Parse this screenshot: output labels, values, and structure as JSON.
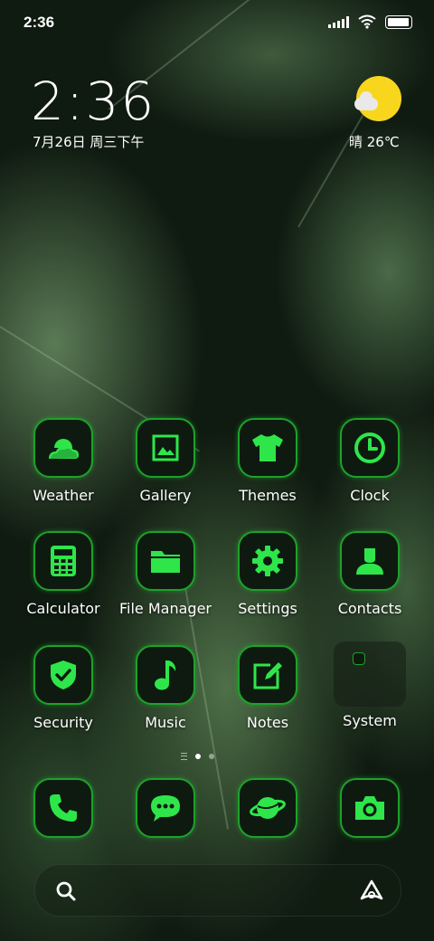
{
  "status_bar": {
    "time": "2:36"
  },
  "lockwidget": {
    "time": "2:36",
    "date": "7月26日 周三下午",
    "weather": "晴 26℃"
  },
  "apps": [
    {
      "label": "Weather",
      "icon": "weather-icon"
    },
    {
      "label": "Gallery",
      "icon": "gallery-icon"
    },
    {
      "label": "Themes",
      "icon": "tshirt-icon"
    },
    {
      "label": "Clock",
      "icon": "clock-icon"
    },
    {
      "label": "Calculator",
      "icon": "calculator-icon"
    },
    {
      "label": "File Manager",
      "icon": "folder-icon"
    },
    {
      "label": "Settings",
      "icon": "gear-icon"
    },
    {
      "label": "Contacts",
      "icon": "contact-icon"
    },
    {
      "label": "Security",
      "icon": "shield-icon"
    },
    {
      "label": "Music",
      "icon": "music-note-icon"
    },
    {
      "label": "Notes",
      "icon": "notes-icon"
    },
    {
      "label": "System",
      "icon": "folder-group-icon"
    }
  ],
  "dock": [
    {
      "icon": "phone-icon"
    },
    {
      "icon": "messages-icon"
    },
    {
      "icon": "browser-planet-icon"
    },
    {
      "icon": "camera-icon"
    }
  ],
  "page_indicator": {
    "pages": 2,
    "active": 1
  },
  "colors": {
    "accent": "#2ee64a",
    "icon_border": "#1ea12a",
    "sun": "#f8d61e"
  }
}
